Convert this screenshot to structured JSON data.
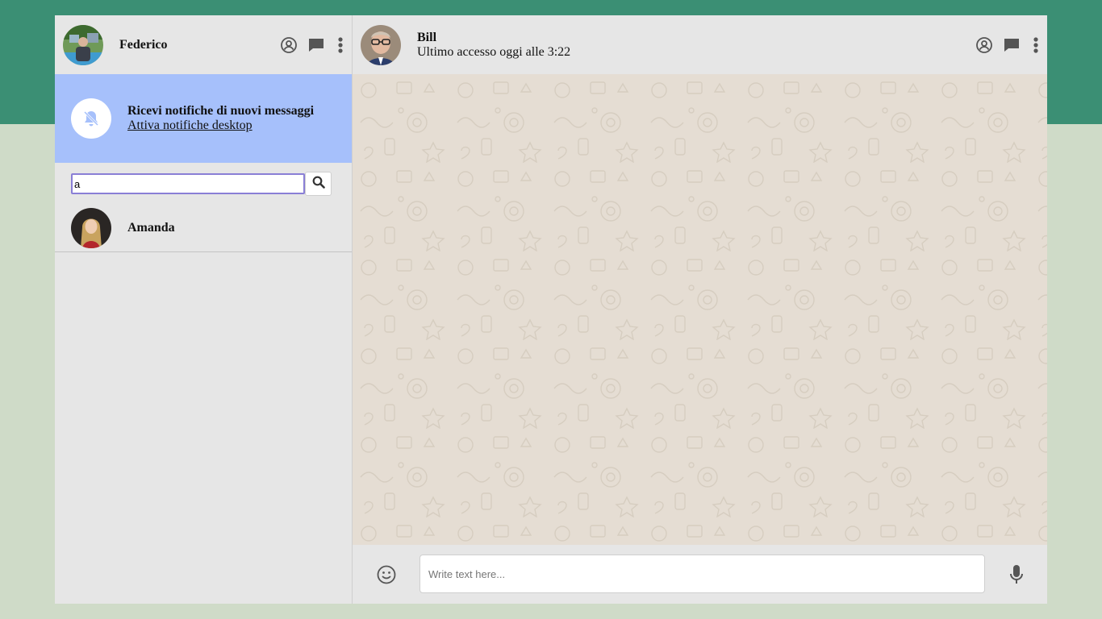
{
  "sidebar": {
    "user": {
      "name": "Federico",
      "avatar_icon": "user-avatar"
    },
    "header_icons": [
      "status-icon",
      "new-chat-icon",
      "menu-icon"
    ],
    "notification": {
      "title": "Ricevi notifiche di nuovi messaggi",
      "link": "Attiva notifiche desktop",
      "icon": "bell-off-icon"
    },
    "search": {
      "value": "a",
      "button_icon": "search-icon"
    },
    "contacts": [
      {
        "name": "Amanda"
      }
    ]
  },
  "chat": {
    "contact": {
      "name": "Bill",
      "last_seen": "Ultimo accesso oggi alle 3:22"
    },
    "header_icons": [
      "status-icon",
      "new-chat-icon",
      "menu-icon"
    ],
    "composer": {
      "placeholder": "Write text here...",
      "emoji_icon": "emoji-icon",
      "mic_icon": "mic-icon"
    }
  },
  "colors": {
    "top_band": "#3b8f74",
    "page_background": "#cfdbc8",
    "notification_background": "#a6c0fb",
    "chat_wallpaper": "#e5ddd3",
    "panel": "#e6e6e6"
  }
}
